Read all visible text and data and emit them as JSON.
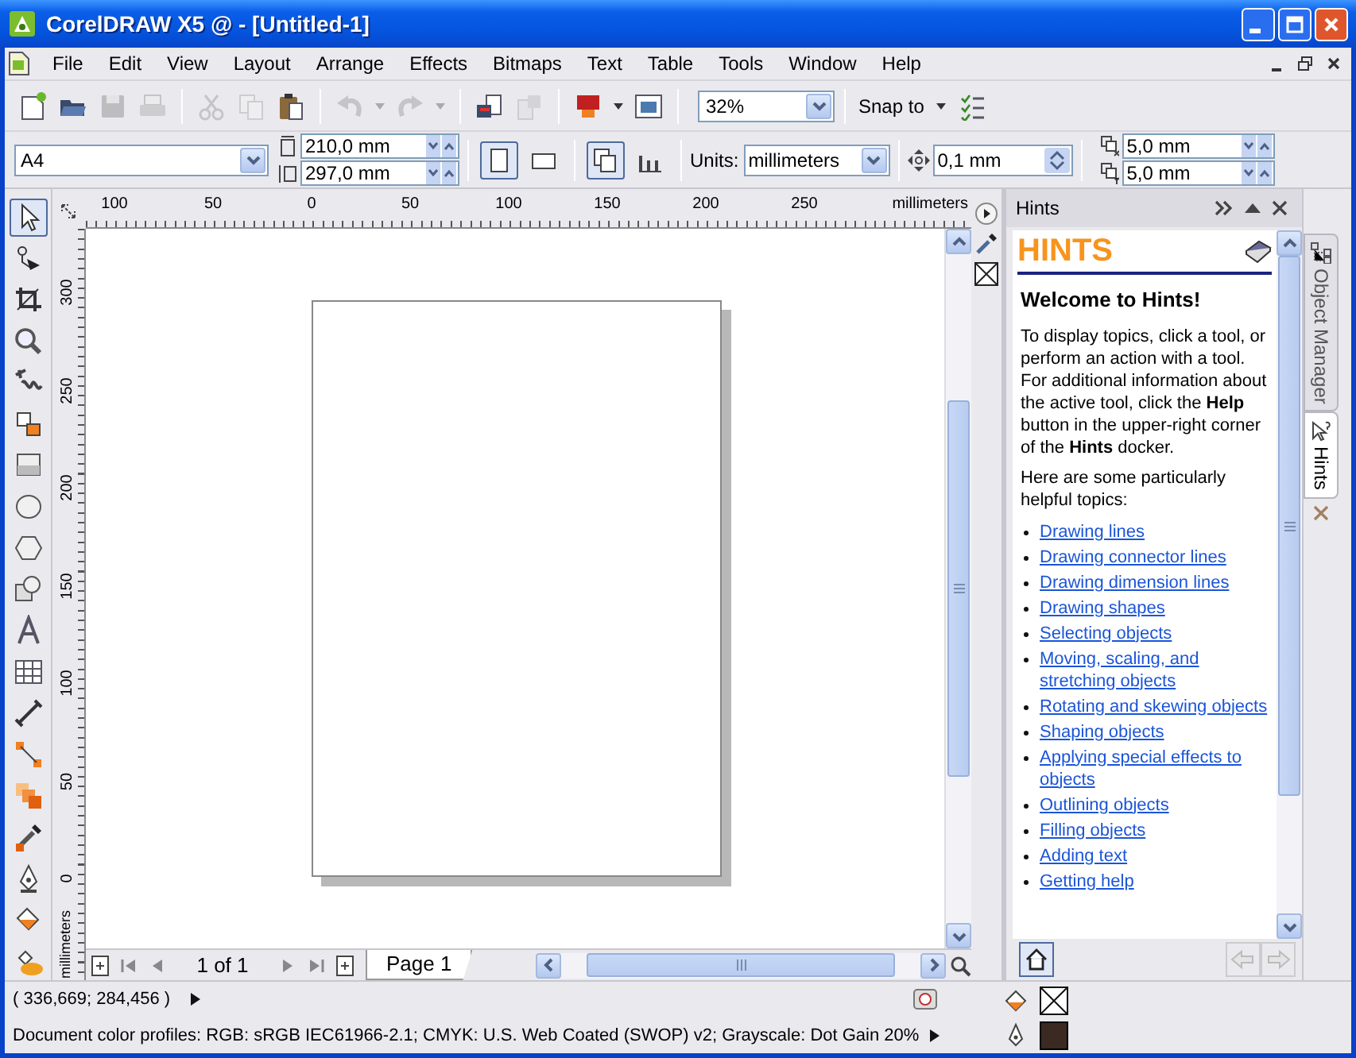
{
  "window": {
    "title": "CorelDRAW X5 @ - [Untitled-1]"
  },
  "menu": [
    "File",
    "Edit",
    "View",
    "Layout",
    "Arrange",
    "Effects",
    "Bitmaps",
    "Text",
    "Table",
    "Tools",
    "Window",
    "Help"
  ],
  "standard_toolbar": {
    "buttons": [
      {
        "disabled": false
      },
      {
        "disabled": false
      },
      {
        "disabled": true
      },
      {
        "disabled": true
      },
      {
        "disabled": true
      },
      {
        "disabled": true
      },
      {
        "disabled": false
      },
      {
        "disabled": true
      },
      {
        "disabled": true
      },
      {
        "disabled": false
      },
      {
        "disabled": true
      },
      {
        "disabled": false
      },
      {
        "disabled": false
      }
    ],
    "zoom": "32%",
    "snap_to": "Snap to"
  },
  "property_bar": {
    "page_size": "A4",
    "width": "210,0 mm",
    "height": "297,0 mm",
    "orientation": [
      {
        "selected": true
      },
      {
        "selected": false
      }
    ],
    "page_layout": [
      {
        "selected": true
      },
      {
        "selected": false
      }
    ],
    "units_label": "Units:",
    "units": "millimeters",
    "nudge": "0,1 mm",
    "duplicate_x": "5,0 mm",
    "duplicate_y": "5,0 mm"
  },
  "toolbox": [
    {
      "selected": true
    },
    {
      "selected": false
    },
    {
      "selected": false
    },
    {
      "selected": false
    },
    {
      "selected": false
    },
    {
      "selected": false
    },
    {
      "selected": false
    },
    {
      "selected": false
    },
    {
      "selected": false
    },
    {
      "selected": false
    },
    {
      "selected": false
    },
    {
      "selected": false
    },
    {
      "selected": false
    },
    {
      "selected": false
    },
    {
      "selected": false
    },
    {
      "selected": false
    },
    {
      "selected": false
    },
    {
      "selected": false
    },
    {
      "selected": false
    }
  ],
  "rulers": {
    "horizontal": [
      "100",
      "50",
      "0",
      "50",
      "100",
      "150",
      "200",
      "250"
    ],
    "horizontal_unit": "millimeters",
    "vertical": [
      "300",
      "250",
      "200",
      "150",
      "100",
      "50",
      "0"
    ],
    "vertical_unit": "millimeters"
  },
  "page_navigator": {
    "page_count": "1 of 1",
    "page_tab": "Page 1"
  },
  "hints_docker": {
    "title": "Hints",
    "heading": "HINTS",
    "welcome": "Welcome to Hints!",
    "intro": "To display topics, click a tool, or perform an action with a tool. For additional information about the active tool, click the **Help** button in the upper-right corner of the **Hints** docker.",
    "topics_intro": "Here are some particularly helpful topics:",
    "topics": [
      "Drawing lines",
      "Drawing connector lines",
      "Drawing dimension lines",
      "Drawing shapes",
      "Selecting objects",
      "Moving, scaling, and stretching objects",
      "Rotating and skewing objects",
      "Shaping objects",
      "Applying special effects to objects",
      "Outlining objects",
      "Filling objects",
      "Adding text",
      "Getting help"
    ]
  },
  "docker_tabs": [
    {
      "label": "Object Manager",
      "selected": false
    },
    {
      "label": "Hints",
      "selected": true
    }
  ],
  "status_bar": {
    "coordinates": "( 336,669; 284,456 )",
    "color_profiles": "Document color profiles: RGB: sRGB IEC61966-2.1; CMYK: U.S. Web Coated (SWOP) v2; Grayscale: Dot Gain 20%"
  }
}
